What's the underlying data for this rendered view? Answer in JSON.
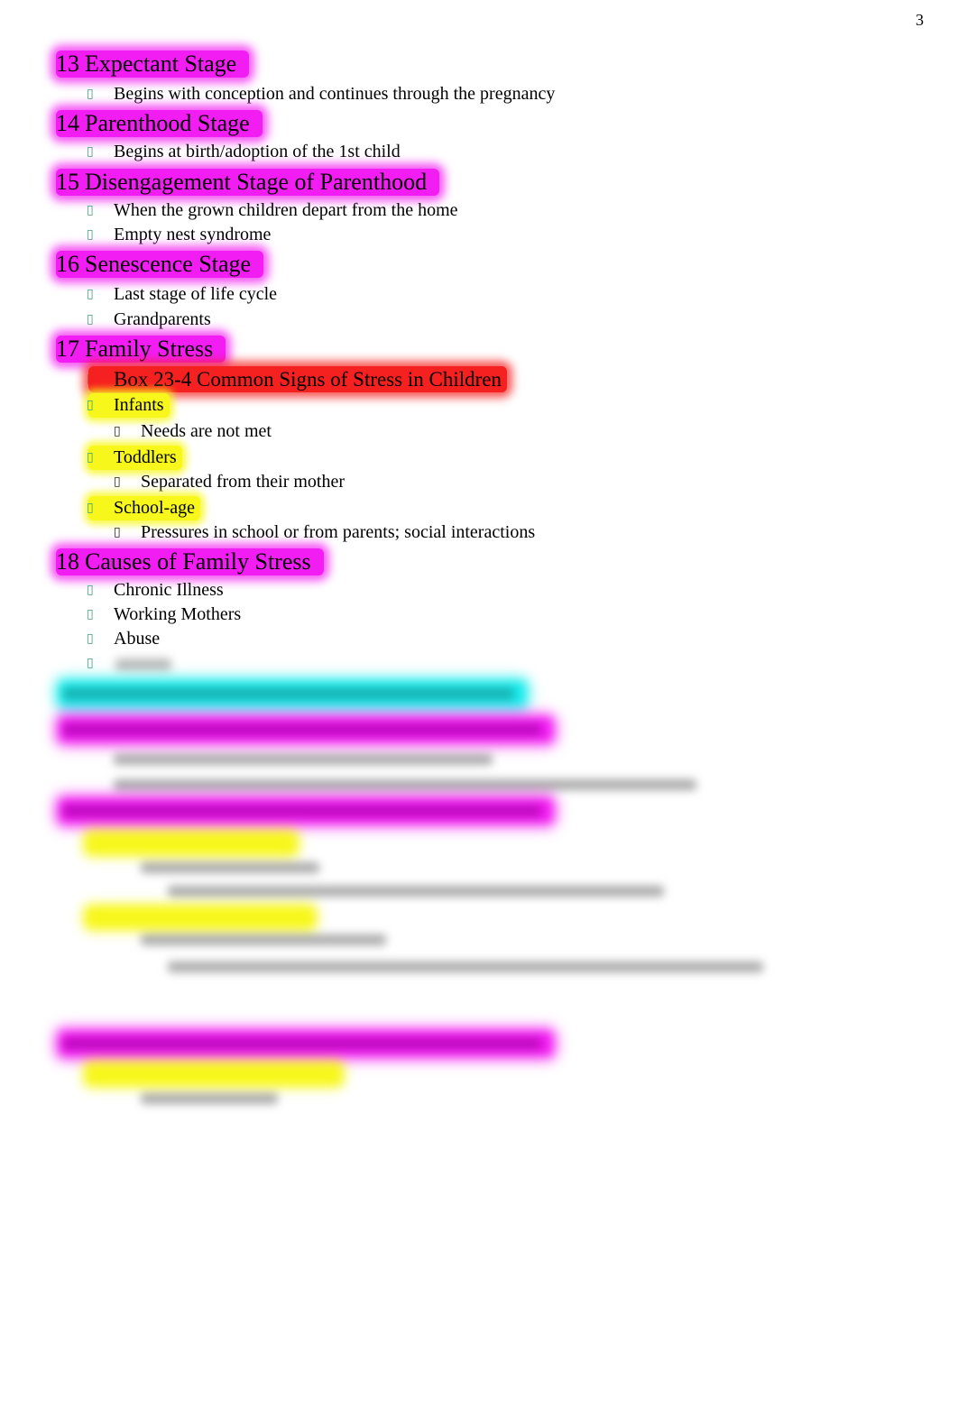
{
  "page_number": "3",
  "sections": [
    {
      "number": "13",
      "title": "Expectant Stage",
      "bullets": [
        "Begins with conception and continues through the pregnancy"
      ]
    },
    {
      "number": "14",
      "title": "Parenthood Stage",
      "bullets": [
        "Begins at birth/adoption of the 1st child"
      ]
    },
    {
      "number": "15",
      "title": "Disengagement Stage of Parenthood",
      "bullets": [
        "When the grown children depart from the home",
        "Empty nest syndrome"
      ]
    },
    {
      "number": "16",
      "title": "Senescence Stage",
      "bullets": [
        "Last stage of life cycle",
        "Grandparents"
      ]
    },
    {
      "number": "17",
      "title": "Family Stress",
      "box_label": "Box 23-4 Common Signs of Stress in Children",
      "groups": [
        {
          "label": "Infants",
          "detail": "Needs are not met"
        },
        {
          "label": "Toddlers",
          "detail": "Separated from their mother"
        },
        {
          "label": "School-age",
          "detail": "Pressures in school or from parents; social interactions"
        }
      ]
    },
    {
      "number": "18",
      "title": "Causes of Family Stress",
      "bullets": [
        "Chronic Illness",
        "Working Mothers",
        "Abuse"
      ]
    }
  ],
  "colors": {
    "heading_highlight": "#f21df2",
    "box_highlight": "#f52020",
    "group_highlight": "#f7f71c",
    "blurred_heading_highlight": "#18ecec",
    "bullet_color": "#3aa374"
  },
  "blurred_region": {
    "note": "remaining content is blurred / not legible"
  }
}
